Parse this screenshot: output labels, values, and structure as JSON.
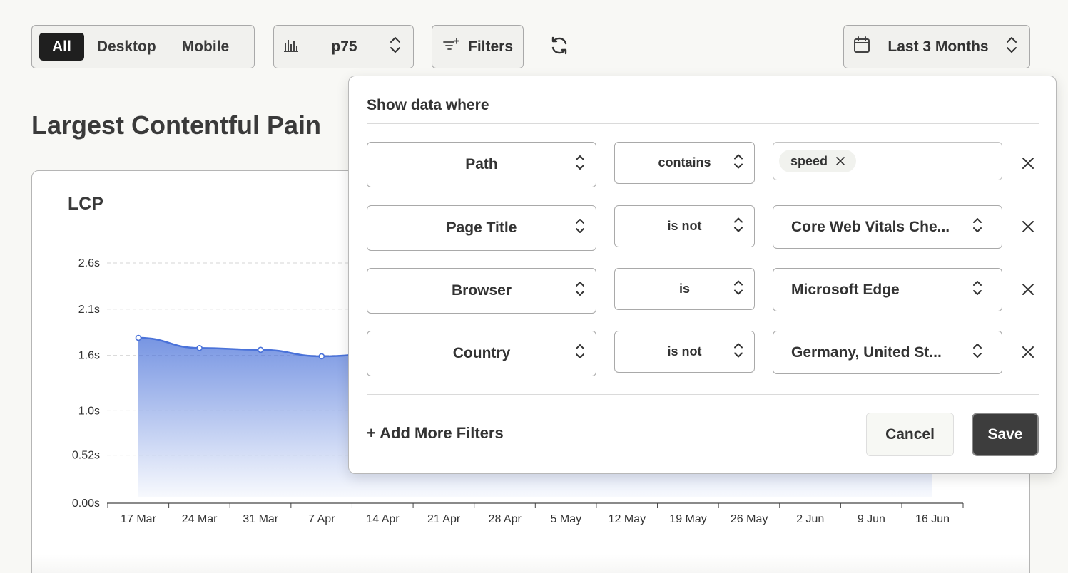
{
  "toolbar": {
    "device_options": [
      "All",
      "Desktop",
      "Mobile"
    ],
    "device_selected": "All",
    "percentile": "p75",
    "filters_label": "Filters",
    "date_range": "Last 3 Months"
  },
  "page": {
    "title": "Largest Contentful Pain"
  },
  "chart": {
    "title": "LCP"
  },
  "chart_data": {
    "type": "area",
    "title": "LCP",
    "x_categories": [
      "17 Mar",
      "24 Mar",
      "31 Mar",
      "7 Apr",
      "14 Apr",
      "21 Apr",
      "28 Apr",
      "5 May",
      "12 May",
      "19 May",
      "26 May",
      "2 Jun",
      "9 Jun",
      "16 Jun"
    ],
    "y_ticks": [
      "0.00s",
      "0.52s",
      "1.0s",
      "1.6s",
      "2.1s",
      "2.6s"
    ],
    "y_tick_values": [
      0.0,
      0.52,
      1.0,
      1.6,
      2.1,
      2.6
    ],
    "ylim": [
      0,
      2.6
    ],
    "visible_points": [
      {
        "x": "17 Mar",
        "y": 1.79
      },
      {
        "x": "24 Mar",
        "y": 1.68
      },
      {
        "x": "31 Mar",
        "y": 1.66
      },
      {
        "x": "7 Apr",
        "y": 1.59
      },
      {
        "x": "14 Apr",
        "y": 1.62
      }
    ],
    "series_color": "#4a72d9",
    "grid": true
  },
  "filter_panel": {
    "heading": "Show data where",
    "rows": [
      {
        "field": "Path",
        "operator": "contains",
        "value_type": "chips",
        "chips": [
          "speed"
        ]
      },
      {
        "field": "Page Title",
        "operator": "is not",
        "value_type": "select",
        "value": "Core Web Vitals Che..."
      },
      {
        "field": "Browser",
        "operator": "is",
        "value_type": "select",
        "value": "Microsoft Edge"
      },
      {
        "field": "Country",
        "operator": "is not",
        "value_type": "select",
        "value": "Germany, United St..."
      }
    ],
    "add_more_label": "+ Add More Filters",
    "cancel_label": "Cancel",
    "save_label": "Save"
  }
}
